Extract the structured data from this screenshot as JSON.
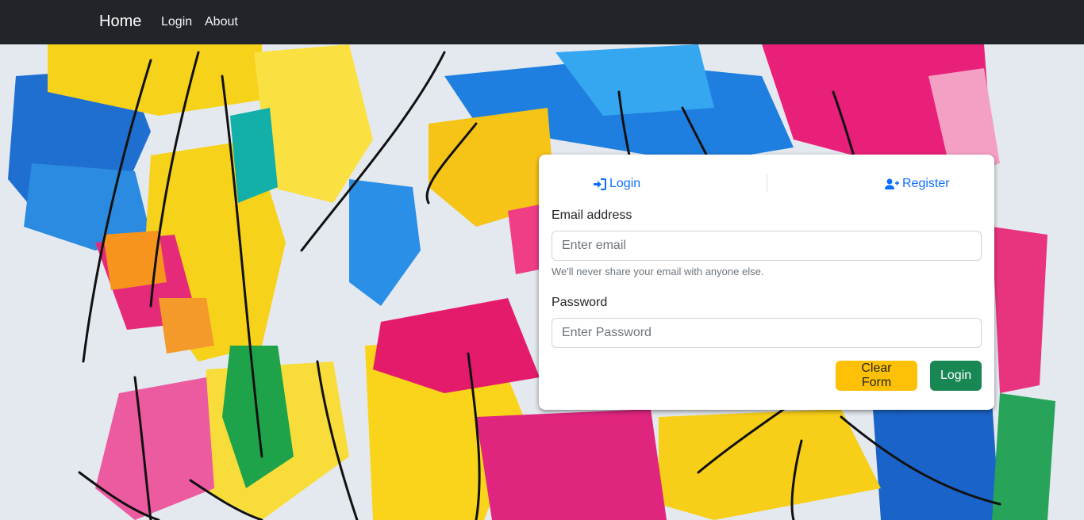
{
  "navbar": {
    "brand": "Home",
    "links": [
      {
        "label": "Login"
      },
      {
        "label": "About"
      }
    ]
  },
  "card": {
    "tabs": [
      {
        "label": "Login",
        "icon": "sign-in-icon"
      },
      {
        "label": "Register",
        "icon": "user-plus-icon"
      }
    ],
    "email": {
      "label": "Email address",
      "placeholder": "Enter email",
      "value": "",
      "help": "We'll never share your email with anyone else."
    },
    "password": {
      "label": "Password",
      "placeholder": "Enter Password",
      "value": ""
    },
    "buttons": {
      "clear": "Clear Form",
      "submit": "Login"
    }
  },
  "colors": {
    "navbar_bg": "#212529",
    "link_blue": "#0d6efd",
    "warning_yellow": "#ffc107",
    "success_green": "#198754"
  }
}
